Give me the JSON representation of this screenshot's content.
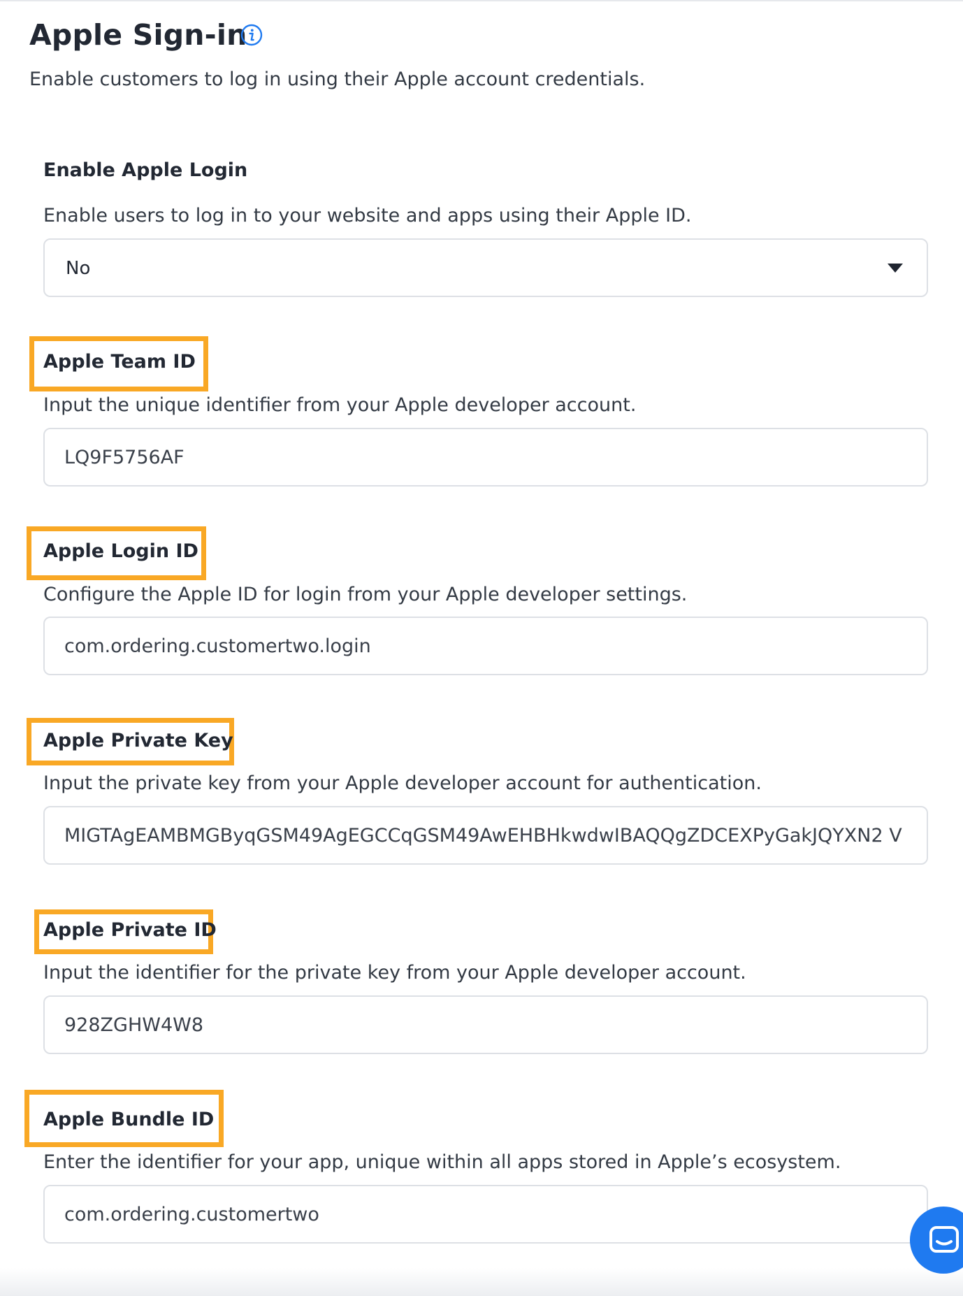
{
  "page": {
    "title": "Apple Sign-in",
    "subtitle": "Enable customers to log in using their Apple account credentials.",
    "info_icon": "info-icon"
  },
  "fields": {
    "enable_login": {
      "label": "Enable Apple Login",
      "description": "Enable users to log in to your website and apps using their Apple ID.",
      "value": "No",
      "icon": "caret-down-icon"
    },
    "team_id": {
      "label": "Apple Team ID",
      "description": "Input the unique identifier from your Apple developer account.",
      "value": "LQ9F5756AF"
    },
    "login_id": {
      "label": "Apple Login ID",
      "description": "Configure the Apple ID for login from your Apple developer settings.",
      "value": "com.ordering.customertwo.login"
    },
    "private_key": {
      "label": "Apple Private Key",
      "description": "Input the private key from your Apple developer account for authentication.",
      "value": "MIGTAgEAMBMGByqGSM49AgEGCCqGSM49AwEHBHkwdwIBAQQgZDCEXPyGakJQYXN2 V"
    },
    "private_id": {
      "label": "Apple Private ID",
      "description": "Input the identifier for the private key from your Apple developer account.",
      "value": "928ZGHW4W8"
    },
    "bundle_id": {
      "label": "Apple Bundle ID",
      "description": "Enter the identifier for your app, unique within all apps stored in Apple’s ecosystem.",
      "value": "com.ordering.customertwo"
    }
  },
  "colors": {
    "highlight": "#f9a825",
    "chat_button": "#1f7af0",
    "info_icon": "#1f7af0"
  },
  "chat": {
    "icon": "chat-icon"
  }
}
